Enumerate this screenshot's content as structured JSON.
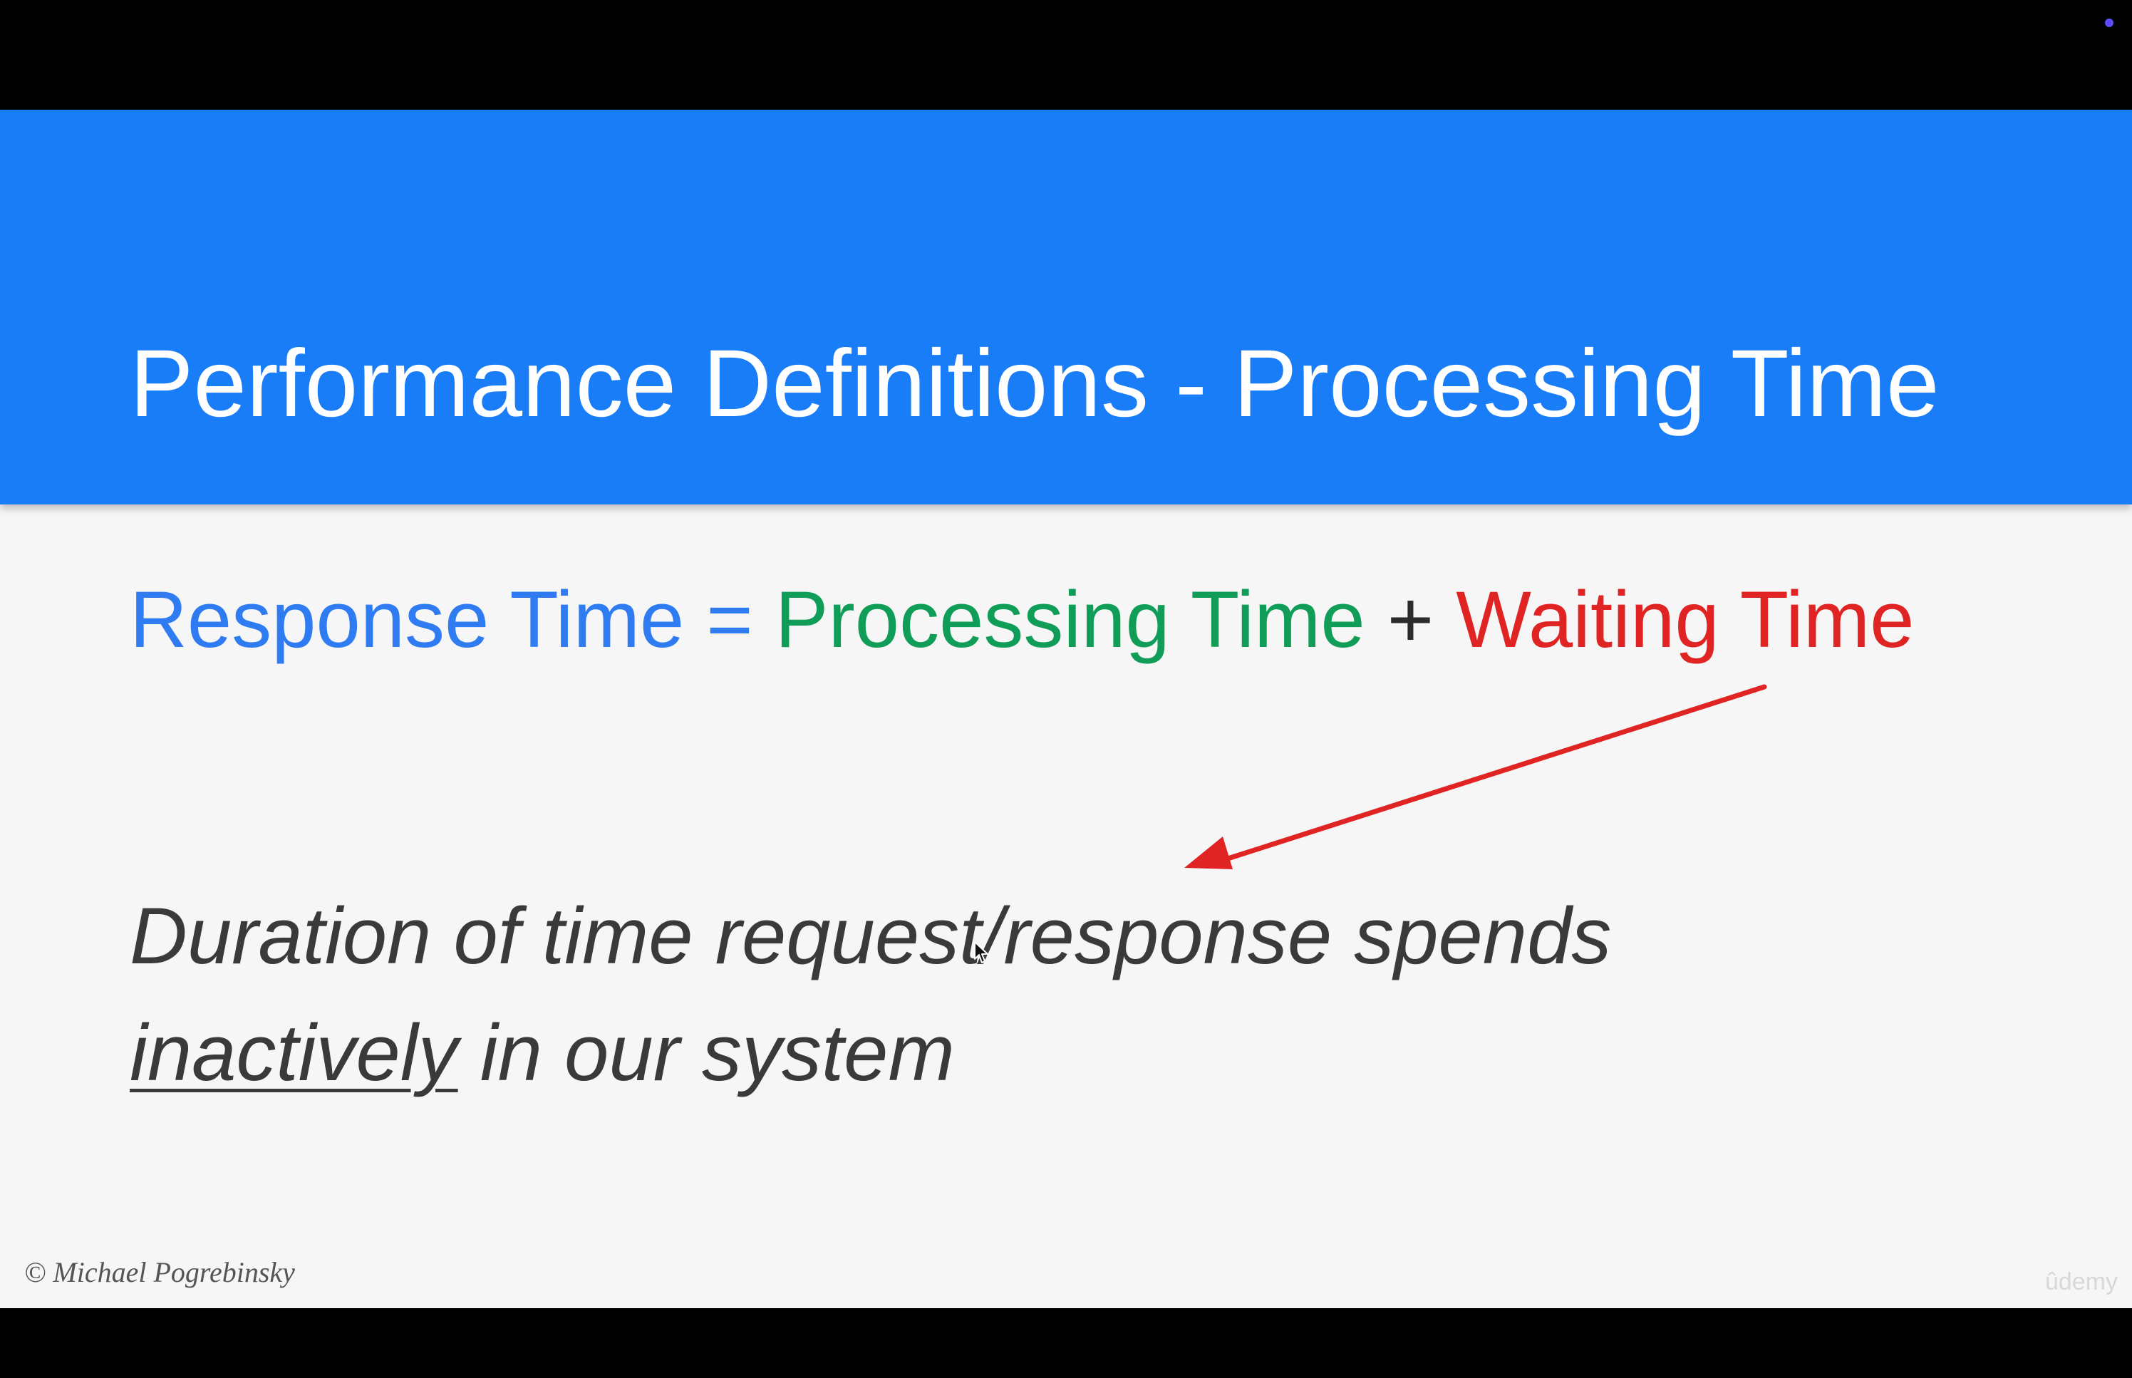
{
  "slide": {
    "title": "Performance Definitions - Processing Time",
    "equation": {
      "response_time": "Response Time",
      "equals": " = ",
      "processing_time": "Processing Time",
      "plus": " + ",
      "waiting_time": "Waiting Time"
    },
    "definition": {
      "line1": "Duration of time request/response spends",
      "emphasis": "inactively",
      "line2_rest": " in our system"
    },
    "copyright": "© Michael Pogrebinsky",
    "watermark": "ûdemy",
    "arrow_icon": "arrow-icon",
    "cursor_icon": "cursor-icon"
  },
  "colors": {
    "header_bar": "#1a7df8",
    "response_time": "#2f7bf2",
    "processing_time": "#0f9d58",
    "operator": "#2b2b2b",
    "waiting_time": "#e02424",
    "arrow": "#e02424",
    "slide_background": "#f6f6f6",
    "frame": "#000000"
  }
}
